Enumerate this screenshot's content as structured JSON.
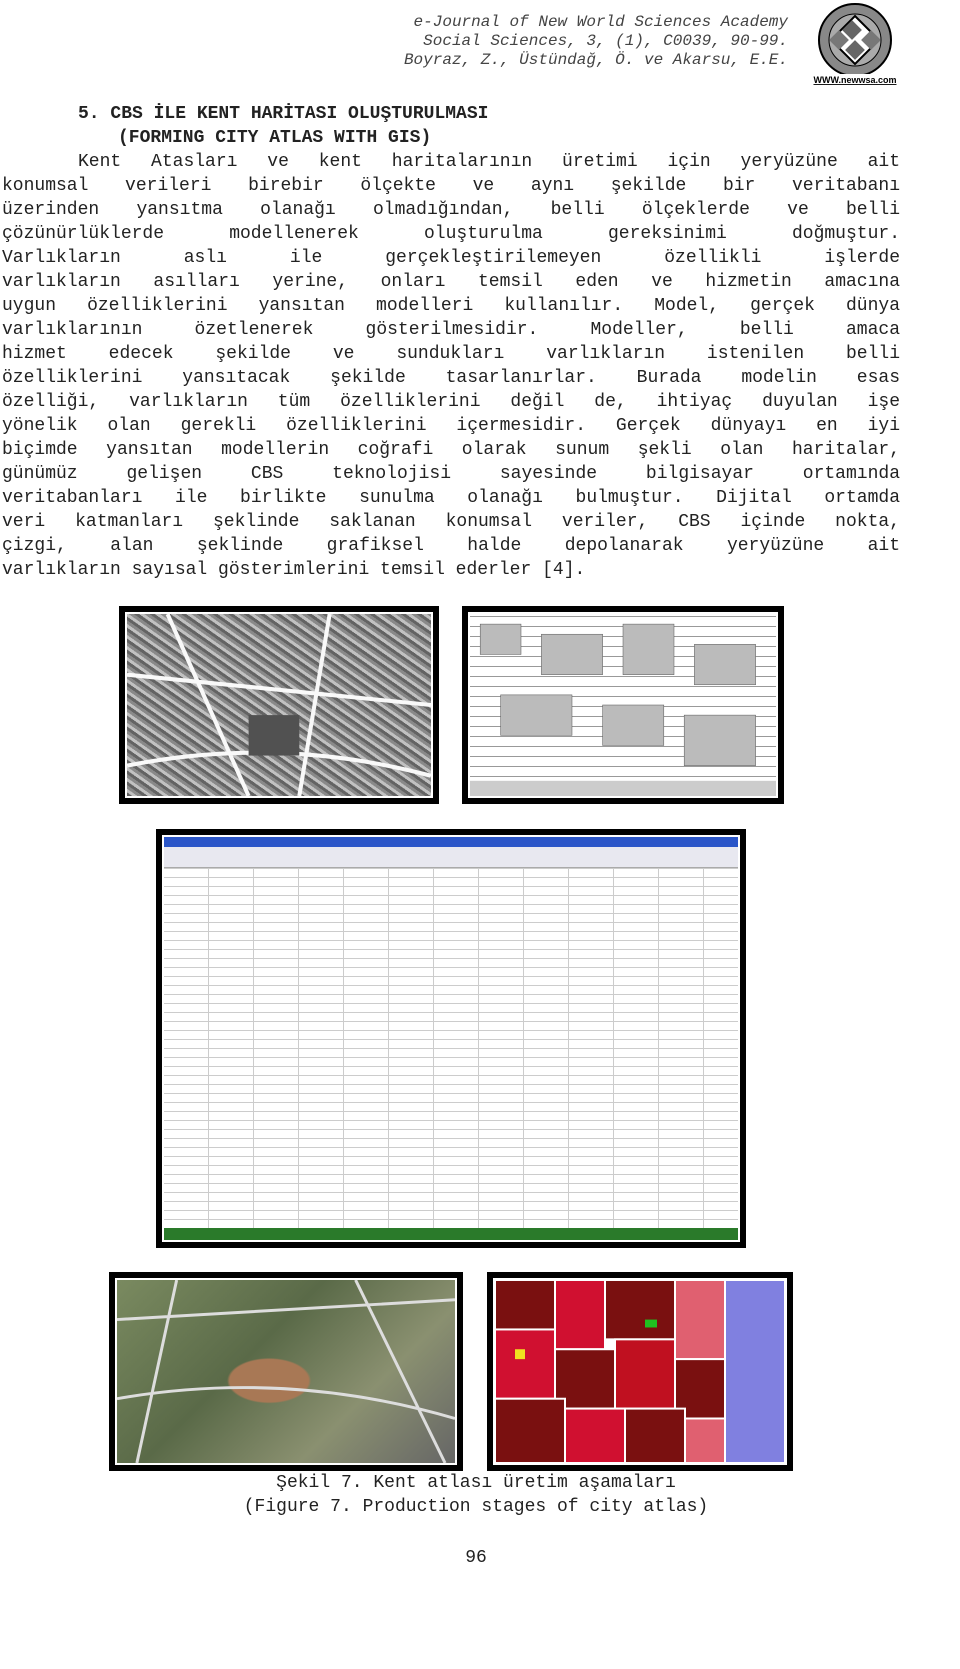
{
  "header": {
    "journal": "e-Journal of New World Sciences Academy",
    "citation": "Social Sciences, 3, (1), C0039, 90-99.",
    "authors": "Boyraz, Z., Üstündağ, Ö. ve Akarsu, E.E.",
    "logo_text": "NEW WORLD SCIENCES ACADEMY NWSA www.newwsa.com"
  },
  "section": {
    "title": "5. CBS İLE KENT HARİTASI OLUŞTURULMASI",
    "subtitle": "(FORMING CITY ATLAS WITH GIS)"
  },
  "paragraph_lines": [
    "Kent Atasları ve kent haritalarının üretimi için yeryüzüne ait",
    "konumsal verileri birebir ölçekte ve aynı şekilde bir veritabanı",
    "üzerinden yansıtma olanağı olmadığından, belli ölçeklerde ve belli",
    "çözünürlüklerde modellenerek oluşturulma gereksinimi doğmuştur.",
    "Varlıkların aslı ile gerçekleştirilemeyen özellikli işlerde",
    "varlıkların asılları yerine, onları temsil eden ve hizmetin amacına",
    "uygun özelliklerini yansıtan modelleri kullanılır. Model, gerçek dünya",
    "varlıklarının özetlenerek gösterilmesidir. Modeller, belli amaca",
    "hizmet edecek şekilde ve sundukları varlıkların istenilen belli",
    "özelliklerini yansıtacak şekilde tasarlanırlar. Burada modelin esas",
    "özelliği, varlıkların tüm özelliklerini değil de, ihtiyaç duyulan işe",
    "yönelik olan gerekli özelliklerini içermesidir. Gerçek dünyayı en iyi",
    "biçimde yansıtan modellerin coğrafi olarak sunum şekli olan haritalar,",
    "günümüz gelişen CBS teknolojisi sayesinde bilgisayar ortamında",
    "veritabanları ile birlikte sunulma olanağı bulmuştur. Dijital ortamda",
    "veri katmanları şeklinde saklanan konumsal veriler, CBS içinde nokta,",
    "çizgi, alan şeklinde grafiksel halde depolanarak yeryüzüne ait",
    "varlıkların sayısal gösterimlerini temsil ederler [4]."
  ],
  "figure": {
    "caption_tr": "Şekil 7. Kent atlası üretim aşamaları",
    "caption_en": "(Figure 7. Production stages of city atlas)"
  },
  "page_number": "96"
}
